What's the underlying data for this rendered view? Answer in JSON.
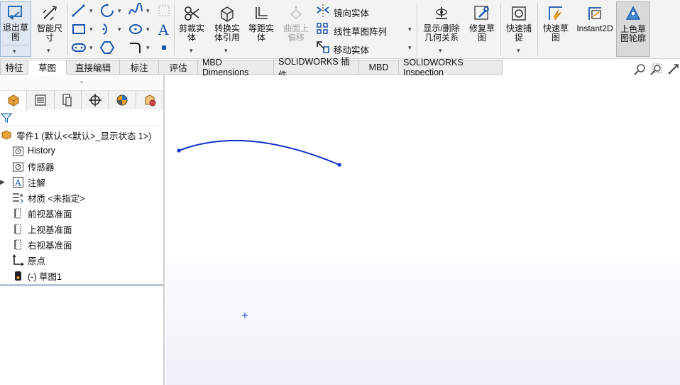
{
  "ribbon": {
    "exit_sketch": "退出草\n图",
    "smart_dimension": "智能尺\n寸",
    "trim": "剪裁实\n体",
    "convert": "转换实\n体引用",
    "offset": "等距实\n体",
    "surface_offset": "曲面上\n偏移",
    "mirror": "镜向实体",
    "linear_pattern": "线性草图阵列",
    "move": "移动实体",
    "display_relations": "显示/删除\n几何关系",
    "repair_sketch": "修复草\n图",
    "quick_snaps": "快速捕\n捉",
    "rapid_sketch": "快速草\n图",
    "instant2d": "Instant2D",
    "shaded_sketch": "上色草\n图轮廓"
  },
  "tabs": [
    "特征",
    "草图",
    "直接编辑",
    "标注",
    "评估",
    "MBD Dimensions",
    "SOLIDWORKS 插件",
    "MBD",
    "SOLIDWORKS Inspection"
  ],
  "active_tab": "草图",
  "tree": {
    "root": "零件1  (默认<<默认>_显示状态 1>)",
    "items": [
      "History",
      "传感器",
      "注解",
      "材质 <未指定>",
      "前视基准面",
      "上视基准面",
      "右视基准面",
      "原点",
      "(-) 草图1"
    ]
  },
  "colors": {
    "sketch_curve": "#1030d0",
    "accent": "#2a6ebb"
  }
}
